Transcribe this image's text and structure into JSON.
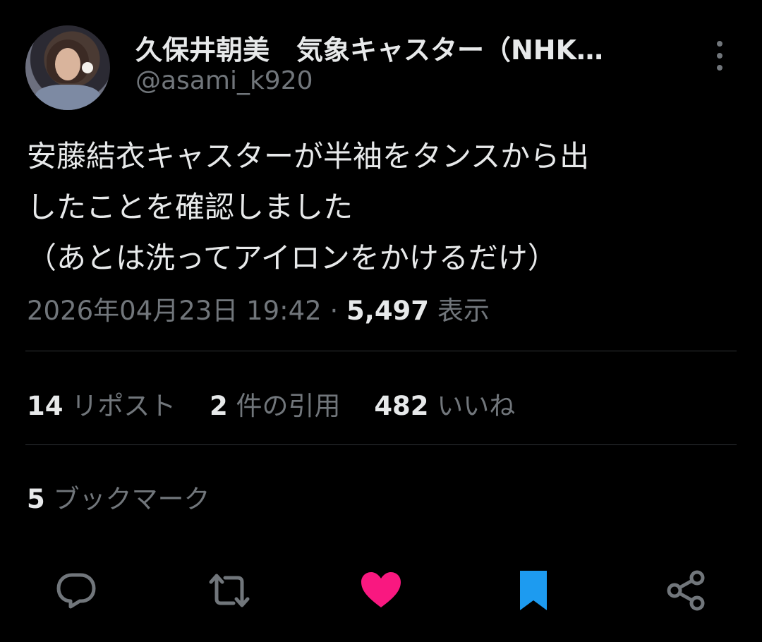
{
  "author": {
    "display_name": "久保井朝美　気象キャスター（NHK…",
    "handle": "@asami_k920"
  },
  "tweet": {
    "text": "安藤結衣キャスターが半袖をタンスから出\nしたことを確認しました\n（あとは洗ってアイロンをかけるだけ）"
  },
  "meta": {
    "timestamp": "2026年04月23日 19:42",
    "separator": " · ",
    "views_count": "5,497",
    "views_label": " 表示"
  },
  "stats": {
    "reposts_count": "14",
    "reposts_label": " リポスト",
    "quotes_count": "2",
    "quotes_label": " 件の引用",
    "likes_count": "482",
    "likes_label": " いいね"
  },
  "bookmarks": {
    "count": "5",
    "label": " ブックマーク"
  },
  "colors": {
    "background": "#000000",
    "text": "#e7e9ea",
    "muted": "#71767b",
    "like_active": "#f91880",
    "bookmark_active": "#1d9bf0"
  },
  "icons": {
    "reply": "reply-icon",
    "retweet": "retweet-icon",
    "like": "heart-icon",
    "bookmark": "bookmark-icon",
    "share": "share-icon",
    "more": "more-vertical-icon"
  }
}
